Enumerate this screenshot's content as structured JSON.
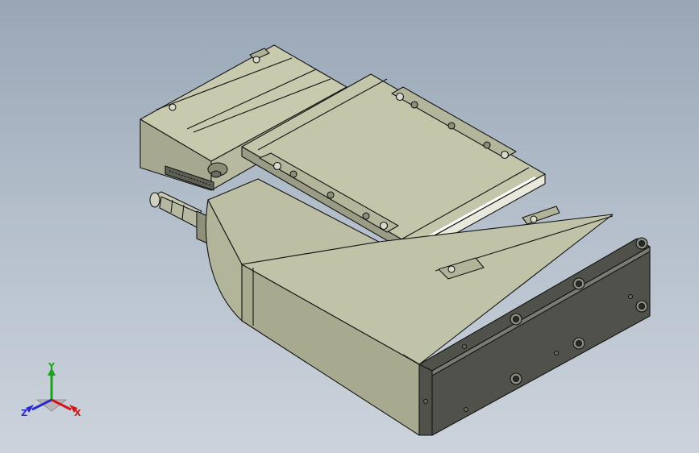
{
  "viewport": {
    "background_top": "#98a6b6",
    "background_bottom": "#ccd3dc"
  },
  "model": {
    "body_color": "#a3a68e",
    "end_plate_color": "#4f514a",
    "edge_color": "#141414"
  },
  "triad": {
    "x_label": "X",
    "y_label": "Y",
    "z_label": "Z",
    "x_color": "#d41616",
    "y_color": "#19a319",
    "z_color": "#2a2acc"
  }
}
